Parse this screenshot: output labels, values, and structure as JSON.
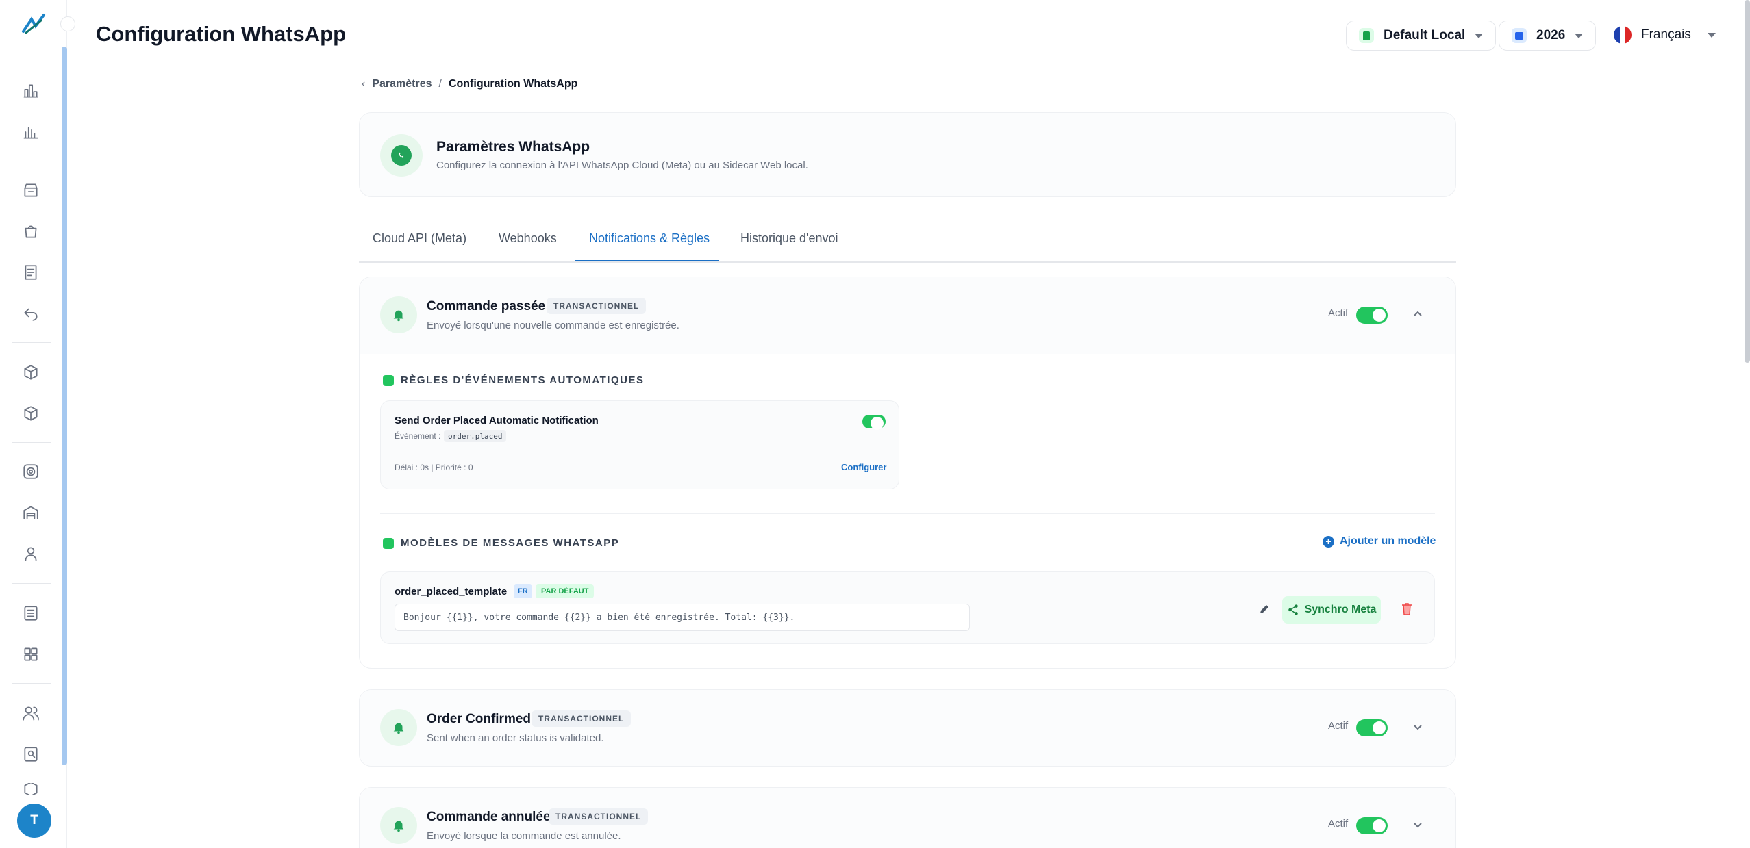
{
  "header": {
    "title": "Configuration WhatsApp",
    "store": "Default Local",
    "year": "2026",
    "language": "Français"
  },
  "breadcrumb": {
    "parent": "Paramètres",
    "separator": "/",
    "current": "Configuration WhatsApp"
  },
  "settings": {
    "title": "Paramètres WhatsApp",
    "description": "Configurez la connexion à l'API WhatsApp Cloud (Meta) ou au Sidecar Web local."
  },
  "tabs": [
    {
      "label": "Cloud API (Meta)",
      "active": false
    },
    {
      "label": "Webhooks",
      "active": false
    },
    {
      "label": "Notifications & Règles",
      "active": true
    },
    {
      "label": "Historique d'envoi",
      "active": false
    }
  ],
  "events": [
    {
      "title": "Commande passée",
      "tag": "TRANSACTIONNEL",
      "description": "Envoyé lorsqu'une nouvelle commande est enregistrée.",
      "status": "Actif",
      "enabled": true,
      "expanded": true
    },
    {
      "title": "Order Confirmed",
      "tag": "TRANSACTIONNEL",
      "description": "Sent when an order status is validated.",
      "status": "Actif",
      "enabled": true,
      "expanded": false
    },
    {
      "title": "Commande annulée",
      "tag": "TRANSACTIONNEL",
      "description": "Envoyé lorsque la commande est annulée.",
      "status": "Actif",
      "enabled": true,
      "expanded": false
    }
  ],
  "rules": {
    "heading": "RÈGLES D'ÉVÉNEMENTS AUTOMATIQUES",
    "items": [
      {
        "title": "Send Order Placed Automatic Notification",
        "event_label": "Événement :",
        "event_code": "order.placed",
        "meta": "Délai : 0s | Priorité : 0",
        "configure": "Configurer",
        "enabled": true
      }
    ]
  },
  "templates": {
    "heading": "MODÈLES DE MESSAGES WHATSAPP",
    "add_label": "Ajouter un modèle",
    "items": [
      {
        "name": "order_placed_template",
        "lang": "FR",
        "default_tag": "PAR DÉFAUT",
        "body": "Bonjour {{1}}, votre commande {{2}} a bien été enregistrée. Total: {{3}}.",
        "sync_label": "Synchro Meta"
      }
    ]
  },
  "user": {
    "initial": "T"
  },
  "colors": {
    "accent": "#1b6fc5",
    "success": "#22c55e",
    "danger": "#ef4444",
    "avatar": "#1d84c9"
  },
  "icons": {
    "sidebar": [
      "chart-bar-icon",
      "analytics-icon",
      "store-icon",
      "shopping-bag-icon",
      "orders-list-icon",
      "return-icon",
      "package-icon",
      "box-icon",
      "target-icon",
      "warehouse-icon",
      "user-icon",
      "report-icon",
      "apps-grid-icon",
      "users-icon",
      "search-doc-icon",
      "settings-icon"
    ]
  }
}
